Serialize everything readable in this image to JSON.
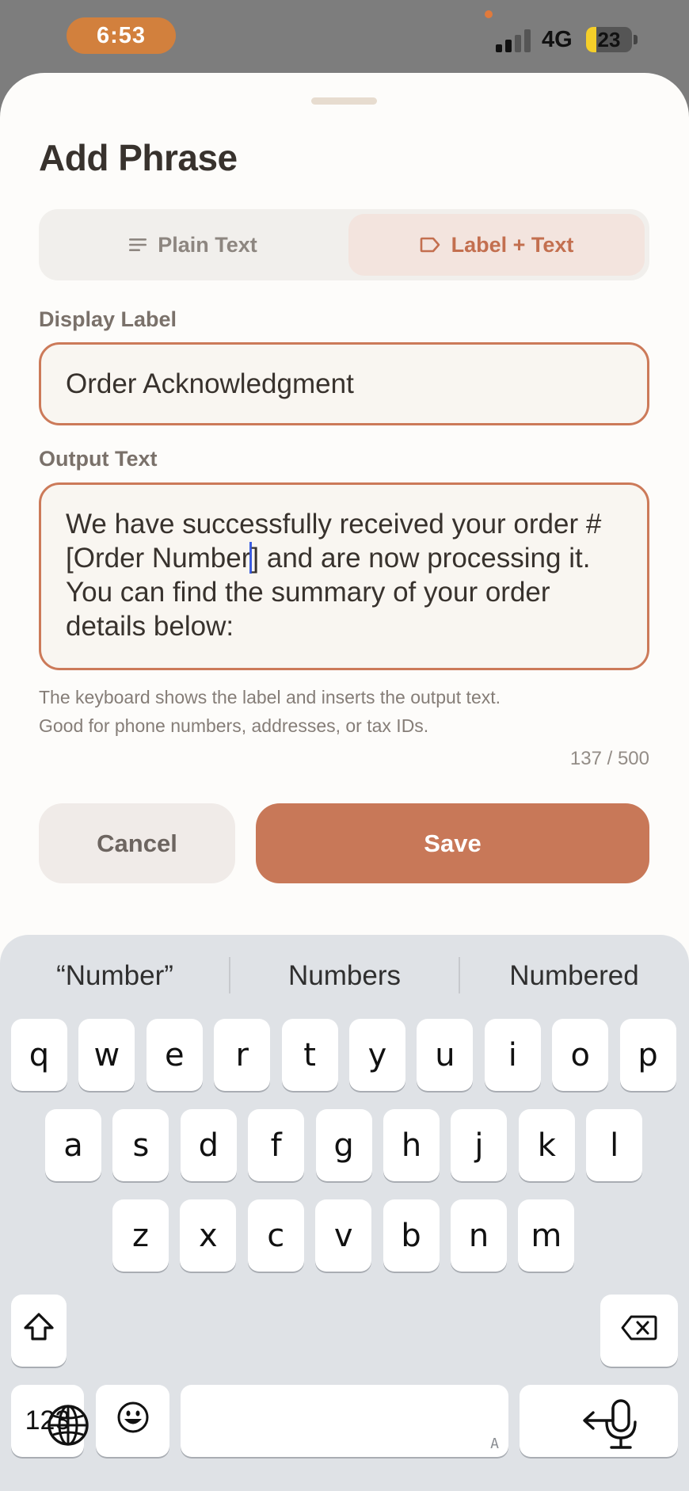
{
  "status_bar": {
    "time": "6:53",
    "network": "4G",
    "battery": "23",
    "battery_level": 0.23,
    "signal_bars_active": 2,
    "signal_bars_total": 4
  },
  "sheet": {
    "title": "Add Phrase",
    "segments": [
      {
        "label": "Plain Text",
        "icon": "lines-icon",
        "selected": false
      },
      {
        "label": "Label + Text",
        "icon": "tag-icon",
        "selected": true
      }
    ],
    "display_label": {
      "label": "Display Label",
      "value": "Order Acknowledgment"
    },
    "output_text": {
      "label": "Output Text",
      "value_before_cursor": "We have successfully received your order #[Order Number",
      "value_after_cursor": "] and are now processing it. You can find the summary of your order details below:"
    },
    "helper_line_1": "The keyboard shows the label and inserts the output text.",
    "helper_line_2": "Good for phone numbers, addresses, or tax IDs.",
    "char_count": "137 / 500",
    "cancel_label": "Cancel",
    "save_label": "Save"
  },
  "keyboard": {
    "suggestions": [
      "“Number”",
      "Numbers",
      "Numbered"
    ],
    "row1": [
      "q",
      "w",
      "e",
      "r",
      "t",
      "y",
      "u",
      "i",
      "o",
      "p"
    ],
    "row2": [
      "a",
      "s",
      "d",
      "f",
      "g",
      "h",
      "j",
      "k",
      "l"
    ],
    "row3": [
      "z",
      "x",
      "c",
      "v",
      "b",
      "n",
      "m"
    ],
    "numbers_key": "123",
    "space_mark": "A"
  },
  "colors": {
    "accent": "#c87858",
    "field_border": "#cc7a59",
    "time_pill": "#d2803d"
  }
}
